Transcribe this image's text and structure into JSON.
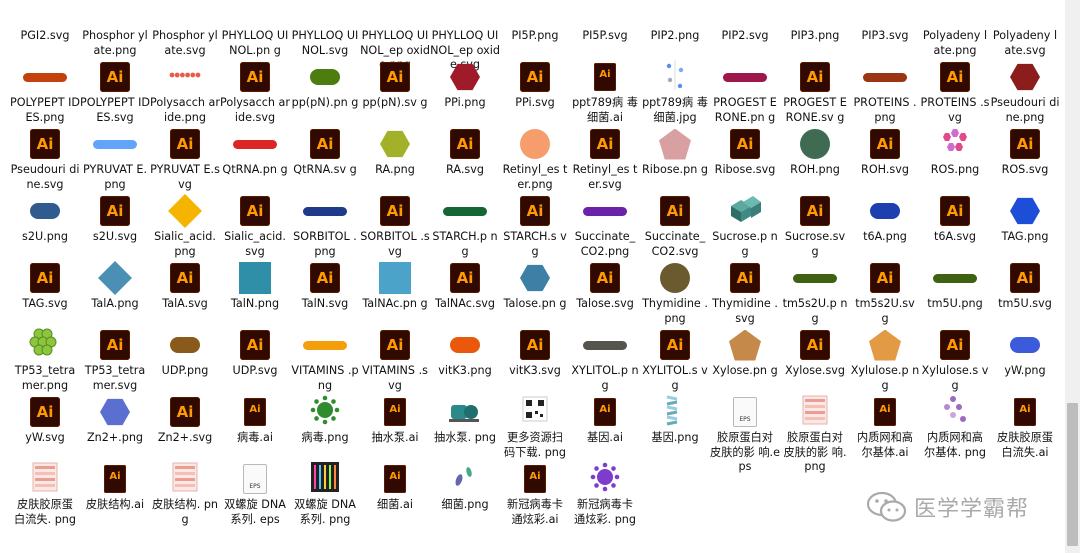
{
  "rows": [
    [
      "PGI2.svg",
      "Phosphor ylate.png",
      "Phosphor ylate.svg",
      "PHYLLOQ UINOL.pn g",
      "PHYLLOQ UINOL.svg",
      "PHYLLOQ UINOL_ep oxide.png",
      "PHYLLOQ UINOL_ep oxide.svg",
      "PI5P.png",
      "PI5P.svg",
      "PIP2.png",
      "PIP2.svg",
      "PIP3.png",
      "PIP3.svg",
      "Polyadeny late.png",
      "Polyadeny late.svg"
    ],
    [
      "POLYPEPT IDES.png",
      "POLYPEPT IDES.svg",
      "Polysacch aride.png",
      "Polysacch aride.svg",
      "pp(pN).pn g",
      "pp(pN).sv g",
      "PPi.png",
      "PPi.svg",
      "ppt789病 毒细菌.ai",
      "ppt789病 毒细菌.jpg",
      "PROGEST ERONE.pn g",
      "PROGEST ERONE.sv g",
      "PROTEINS .png",
      "PROTEINS .svg",
      "Pseudouri dine.png"
    ],
    [
      "Pseudouri dine.svg",
      "PYRUVAT E.png",
      "PYRUVAT E.svg",
      "QtRNA.pn g",
      "QtRNA.sv g",
      "RA.png",
      "RA.svg",
      "Retinyl_es ter.png",
      "Retinyl_es ter.svg",
      "Ribose.pn g",
      "Ribose.svg",
      "ROH.png",
      "ROH.svg",
      "ROS.png",
      "ROS.svg"
    ],
    [
      "s2U.png",
      "s2U.svg",
      "Sialic_acid. png",
      "Sialic_acid. svg",
      "SORBITOL .png",
      "SORBITOL .svg",
      "STARCH.p ng",
      "STARCH.s vg",
      "Succinate_ CO2.png",
      "Succinate_ CO2.svg",
      "Sucrose.p ng",
      "Sucrose.sv g",
      "t6A.png",
      "t6A.svg",
      "TAG.png"
    ],
    [
      "TAG.svg",
      "TalA.png",
      "TalA.svg",
      "TalN.png",
      "TalN.svg",
      "TalNAc.pn g",
      "TalNAc.svg",
      "Talose.pn g",
      "Talose.svg",
      "Thymidine .png",
      "Thymidine .svg",
      "tm5s2U.p ng",
      "tm5s2U.sv g",
      "tm5U.png",
      "tm5U.svg"
    ],
    [
      "TP53_tetra mer.png",
      "TP53_tetra mer.svg",
      "UDP.png",
      "UDP.svg",
      "VITAMINS .png",
      "VITAMINS .svg",
      "vitK3.png",
      "vitK3.svg",
      "XYLITOL.p ng",
      "XYLITOL.s vg",
      "Xylose.pn g",
      "Xylose.svg",
      "Xylulose.p ng",
      "Xylulose.s vg",
      "yW.png"
    ],
    [
      "yW.svg",
      "Zn2+.png",
      "Zn2+.svg",
      "病毒.ai",
      "病毒.png",
      "抽水泵.ai",
      "抽水泵. png",
      "更多资源扫 码下载. png",
      "基因.ai",
      "基因.png",
      "胶原蛋白对 皮肤的影 响.eps",
      "胶原蛋白对 皮肤的影 响.png",
      "内质网和高 尔基体.ai",
      "内质网和高 尔基体. png",
      "皮肤胶原蛋 白流失.ai"
    ],
    [
      "皮肤胶原蛋 白流失. png",
      "皮肤结构.ai",
      "皮肤结构. png",
      "双螺旋 DNA系列. eps",
      "双螺旋 DNA系列. png",
      "细菌.ai",
      "细菌.png",
      "新冠病毒卡 通炫彩.ai",
      "新冠病毒卡 通炫彩. png"
    ]
  ],
  "icons": [
    [
      "none",
      "none",
      "none",
      "none",
      "none",
      "none",
      "none",
      "none",
      "none",
      "none",
      "none",
      "none",
      "none",
      "none",
      "none"
    ],
    [
      "badge:POLYPEPTIDES:#c2410c",
      "ai",
      "beads",
      "ai",
      "pill:pp(pN):#4d7c0f",
      "ai",
      "hex:PPi:#a01b2a",
      "ai",
      "aism",
      "dots",
      "badge:PROGESTERONE:#9d174d",
      "ai",
      "badge:PROTEINS:#9a3412",
      "ai",
      "hex:Y:#8b1d1d"
    ],
    [
      "ai",
      "badge:PYRUVATE:#60a5fa",
      "ai",
      "badge:QtRNA:#dc2626",
      "ai",
      "hex:RA:#a3b128",
      "ai",
      "circ:RE:#f59e6b",
      "ai",
      "pent:#d8a0a0",
      "ai",
      "circ:ROH:#3f6b52",
      "ai",
      "molecule",
      "ai"
    ],
    [
      "pill:s2U:#2f5b8f",
      "ai",
      "dia:#f4b400",
      "ai",
      "badge:SORBITOL:#1e3a8a",
      "ai",
      "badge:STARCH:#166534",
      "ai",
      "badge:Succinate+CO2:#6b21a8",
      "ai",
      "cubes",
      "ai",
      "pill:t6A:#1e40af",
      "ai",
      "hex:TAG:#1d4ed8"
    ],
    [
      "ai",
      "dia:#4c8fb5",
      "ai",
      "sq:#2f8fa8",
      "ai",
      "sq:#4ba3c9",
      "ai",
      "hex:#3d7fa5",
      "ai",
      "circ:T:#6b5a30",
      "ai",
      "badge:tm5s2U:#3f6212",
      "ai",
      "badge:tm5U:#3f6212",
      "ai"
    ],
    [
      "grapes",
      "ai",
      "pill:UDP:#8a5a1a",
      "ai",
      "badge:VITAMINS:#f59e0b",
      "ai",
      "pill:vitK3:#ea580c",
      "ai",
      "badge:XYLITOL:#57534e",
      "ai",
      "pent:#c58a4a",
      "ai",
      "pent:#e39a45",
      "ai",
      "pill:yW:#3b5bdb"
    ],
    [
      "ai",
      "hex:Zn2+:#5b6fd0",
      "ai",
      "aism",
      "virus:#2e8b2e",
      "aism",
      "pump",
      "qr",
      "aism",
      "helix",
      "eps",
      "skin",
      "aism",
      "er",
      "aism"
    ],
    [
      "skin",
      "aism",
      "skin",
      "eps",
      "dnaset",
      "aism",
      "bacteria",
      "aism",
      "virus:#7e3ccf"
    ]
  ],
  "watermark": "医学学霸帮",
  "colors": {
    "ai_bg": "#300a00",
    "ai_fg": "#ff9a00"
  },
  "ai_label": "Ai",
  "eps_label": "EPS"
}
